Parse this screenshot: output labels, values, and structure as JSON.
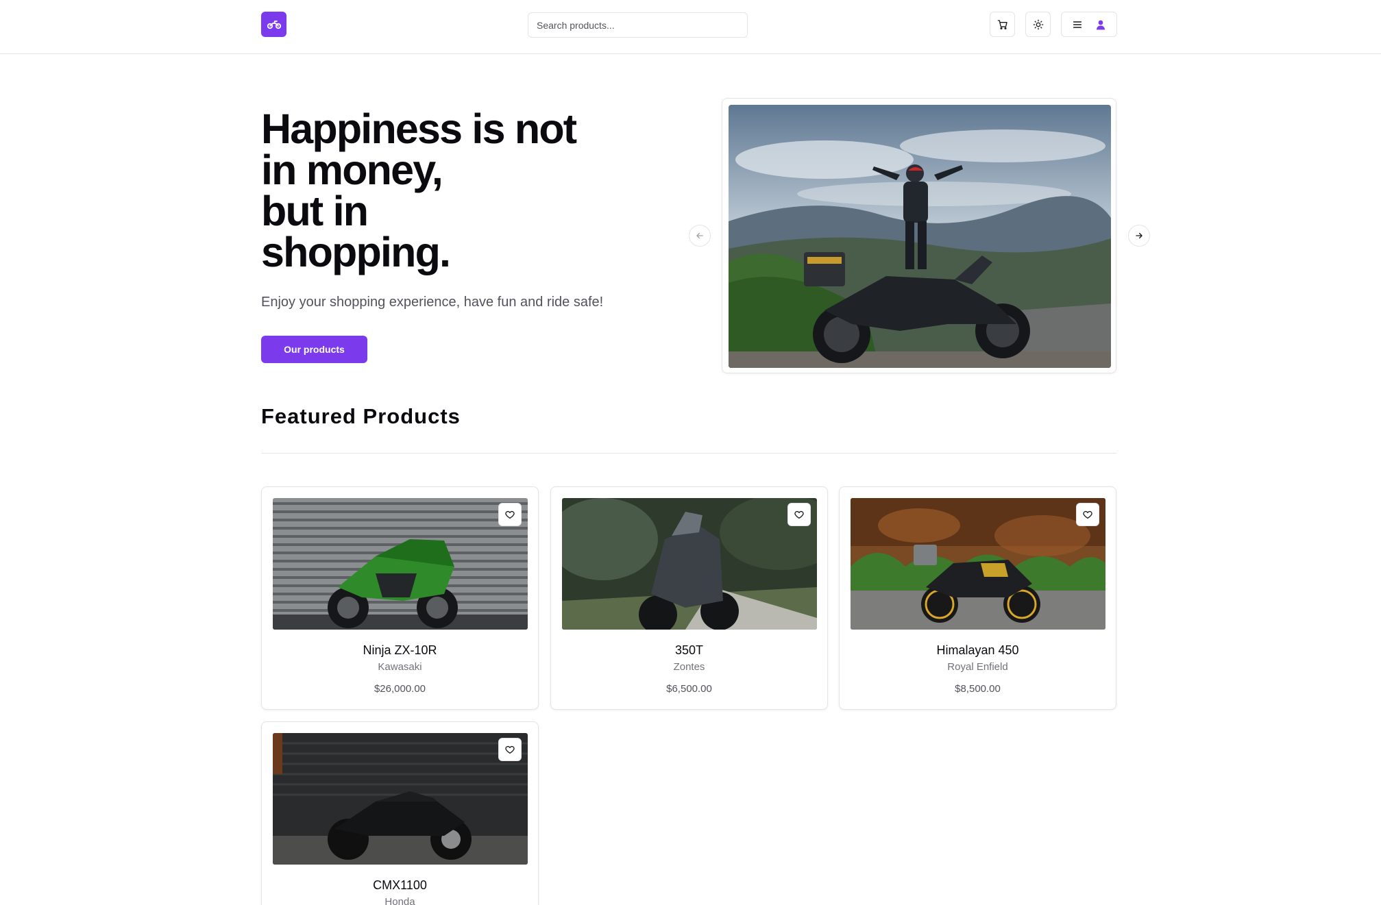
{
  "header": {
    "logo_icon": "motorcycle-icon",
    "search": {
      "placeholder": "Search products...",
      "value": ""
    },
    "cart_icon": "shopping-cart-icon",
    "theme_icon": "sun-icon",
    "menu_icon": "hamburger-menu-icon",
    "user_icon": "user-icon"
  },
  "hero": {
    "title_lines": [
      "Happiness is not",
      "in money,",
      "but in",
      "shopping."
    ],
    "subtitle": "Enjoy your shopping experience, have fun and ride safe!",
    "cta_label": "Our products",
    "carousel": {
      "prev_icon": "arrow-left-icon",
      "next_icon": "arrow-right-icon"
    }
  },
  "featured": {
    "title": "Featured Products",
    "products": [
      {
        "name": "Ninja ZX-10R",
        "brand": "Kawasaki",
        "price": "$26,000.00"
      },
      {
        "name": "350T",
        "brand": "Zontes",
        "price": "$6,500.00"
      },
      {
        "name": "Himalayan 450",
        "brand": "Royal Enfield",
        "price": "$8,500.00"
      },
      {
        "name": "CMX1100",
        "brand": "Honda",
        "price": ""
      }
    ]
  },
  "colors": {
    "accent": "#7c3aed",
    "text": "#0a0a0f",
    "muted": "#71717a",
    "border": "#e4e4e7"
  }
}
